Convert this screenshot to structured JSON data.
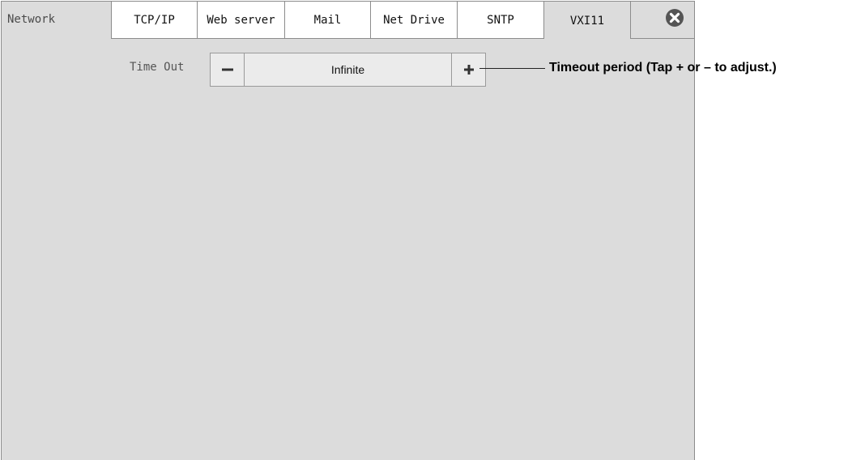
{
  "window": {
    "title": "Network",
    "close_icon": "close-circle-icon"
  },
  "tabs": [
    {
      "label": "TCP/IP",
      "active": false
    },
    {
      "label": "Web server",
      "active": false
    },
    {
      "label": "Mail",
      "active": false
    },
    {
      "label": "Net Drive",
      "active": false
    },
    {
      "label": "SNTP",
      "active": false
    },
    {
      "label": "VXI11",
      "active": true
    }
  ],
  "settings": {
    "timeout": {
      "label": "Time Out",
      "value": "Infinite",
      "decrement_icon": "minus-icon",
      "increment_icon": "plus-icon"
    }
  },
  "annotation": {
    "timeout_callout": "Timeout period (Tap + or – to adjust.)"
  },
  "colors": {
    "panel_background": "#dcdcdc",
    "tab_background": "#ffffff",
    "border": "#8c8c8c",
    "close_icon": "#555555"
  }
}
